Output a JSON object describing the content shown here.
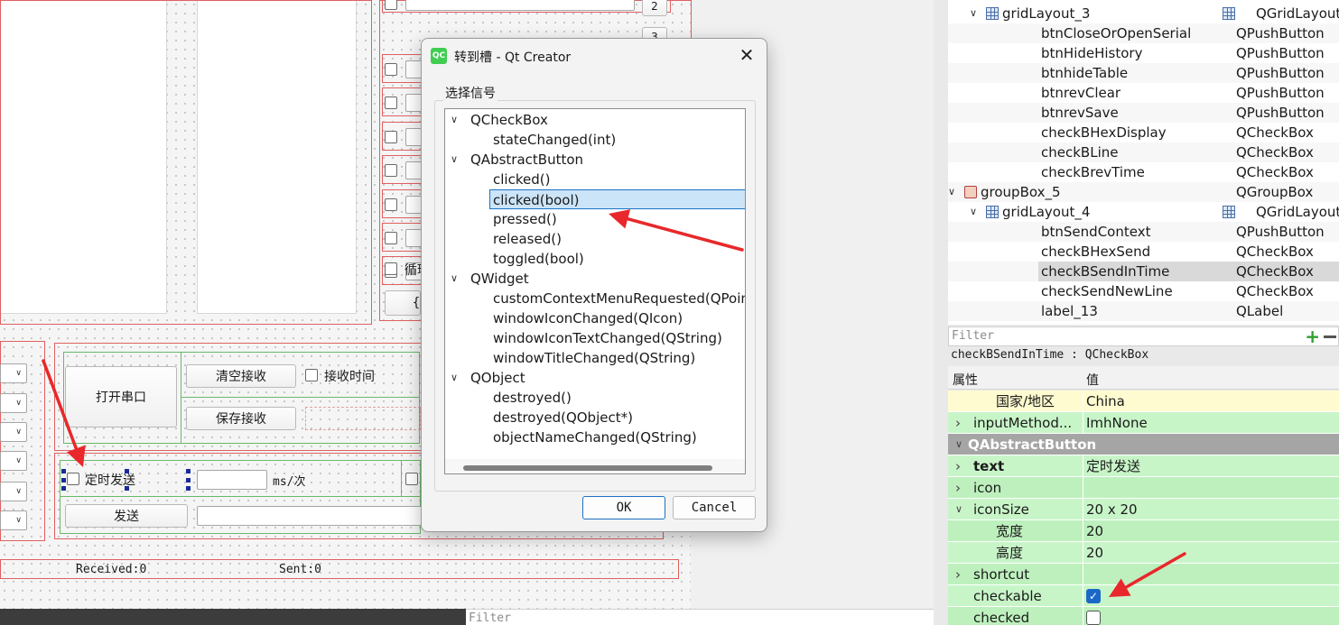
{
  "canvas": {
    "numbers": [
      "2",
      "3"
    ],
    "loop_send_label": "循环",
    "open_serial_label": "打开串口",
    "clear_recv_label": "清空接收",
    "recv_time_label": "接收时间",
    "save_recv_label": "保存接收",
    "timed_send_label": "定时发送",
    "ms_label": "ms/次",
    "send_label": "发送",
    "received_label": "Received:0",
    "sent_label": "Sent:0"
  },
  "dialog": {
    "title": "转到槽 - Qt Creator",
    "icon_text": "QC",
    "group_label": "选择信号",
    "ok_label": "OK",
    "cancel_label": "Cancel",
    "tree": [
      {
        "kind": "class",
        "text": "QCheckBox"
      },
      {
        "kind": "signal",
        "text": "stateChanged(int)"
      },
      {
        "kind": "class",
        "text": "QAbstractButton"
      },
      {
        "kind": "signal",
        "text": "clicked()"
      },
      {
        "kind": "signal",
        "text": "clicked(bool)",
        "selected": true
      },
      {
        "kind": "signal",
        "text": "pressed()"
      },
      {
        "kind": "signal",
        "text": "released()"
      },
      {
        "kind": "signal",
        "text": "toggled(bool)"
      },
      {
        "kind": "class",
        "text": "QWidget"
      },
      {
        "kind": "signal",
        "text": "customContextMenuRequested(QPoint)"
      },
      {
        "kind": "signal",
        "text": "windowIconChanged(QIcon)"
      },
      {
        "kind": "signal",
        "text": "windowIconTextChanged(QString)"
      },
      {
        "kind": "signal",
        "text": "windowTitleChanged(QString)"
      },
      {
        "kind": "class",
        "text": "QObject"
      },
      {
        "kind": "signal",
        "text": "destroyed()"
      },
      {
        "kind": "signal",
        "text": "destroyed(QObject*)"
      },
      {
        "kind": "signal",
        "text": "objectNameChanged(QString)"
      }
    ]
  },
  "object_tree": [
    {
      "name": "gridLayout_3",
      "type": "QGridLayout",
      "level": 2,
      "icon": "grid",
      "expanded": true
    },
    {
      "name": "btnCloseOrOpenSerial",
      "type": "QPushButton",
      "level": 3
    },
    {
      "name": "btnHideHistory",
      "type": "QPushButton",
      "level": 3
    },
    {
      "name": "btnhideTable",
      "type": "QPushButton",
      "level": 3
    },
    {
      "name": "btnrevClear",
      "type": "QPushButton",
      "level": 3
    },
    {
      "name": "btnrevSave",
      "type": "QPushButton",
      "level": 3
    },
    {
      "name": "checkBHexDisplay",
      "type": "QCheckBox",
      "level": 3
    },
    {
      "name": "checkBLine",
      "type": "QCheckBox",
      "level": 3
    },
    {
      "name": "checkBrevTime",
      "type": "QCheckBox",
      "level": 3
    },
    {
      "name": "groupBox_5",
      "type": "QGroupBox",
      "level": 1,
      "icon": "group",
      "expanded": true
    },
    {
      "name": "gridLayout_4",
      "type": "QGridLayout",
      "level": 2,
      "icon": "grid",
      "expanded": true
    },
    {
      "name": "btnSendContext",
      "type": "QPushButton",
      "level": 3
    },
    {
      "name": "checkBHexSend",
      "type": "QCheckBox",
      "level": 3
    },
    {
      "name": "checkBSendInTime",
      "type": "QCheckBox",
      "level": 3,
      "selected": true
    },
    {
      "name": "checkSendNewLine",
      "type": "QCheckBox",
      "level": 3
    },
    {
      "name": "label_13",
      "type": "QLabel",
      "level": 3
    }
  ],
  "filter_placeholder": "Filter",
  "object_caption": "checkBSendInTime : QCheckBox",
  "property_header": {
    "name": "属性",
    "value": "值"
  },
  "properties": [
    {
      "name": "国家/地区",
      "value": "China",
      "style": "yellow",
      "indent": 2
    },
    {
      "name": "inputMethod...",
      "value": "ImhNone",
      "style": "green",
      "expander": "closed",
      "indent": 1
    },
    {
      "name": "QAbstractButton",
      "value": "",
      "style": "section",
      "expander": "open",
      "indent": 0
    },
    {
      "name": "text",
      "value": "定时发送",
      "style": "green",
      "expander": "closed",
      "indent": 1,
      "bold": true
    },
    {
      "name": "icon",
      "value": "",
      "style": "green2",
      "expander": "closed",
      "indent": 1
    },
    {
      "name": "iconSize",
      "value": "20 x 20",
      "style": "green",
      "expander": "open",
      "indent": 1
    },
    {
      "name": "宽度",
      "value": "20",
      "style": "green2",
      "indent": 2
    },
    {
      "name": "高度",
      "value": "20",
      "style": "green",
      "indent": 2
    },
    {
      "name": "shortcut",
      "value": "",
      "style": "green2",
      "expander": "closed",
      "indent": 1
    },
    {
      "name": "checkable",
      "value": "",
      "style": "green",
      "indent": 1,
      "checkbox": true,
      "checked": true
    },
    {
      "name": "checked",
      "value": "",
      "style": "green2",
      "indent": 1,
      "checkbox": true,
      "checked": false
    }
  ],
  "colors": {
    "annotation_arrow": "#e8282b",
    "selection": "#cce4f7",
    "property_green": "#c8f5c8"
  }
}
